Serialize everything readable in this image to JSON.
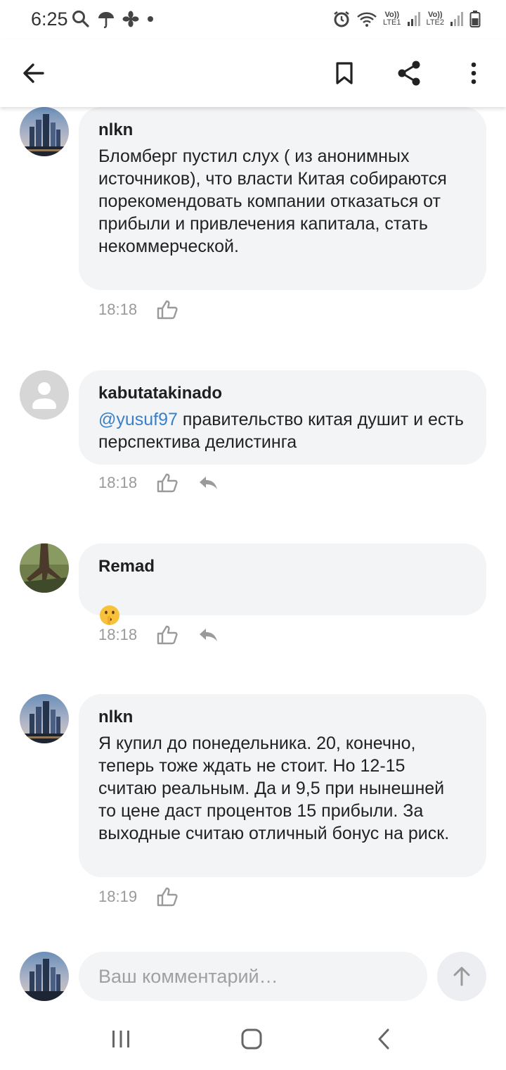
{
  "status_bar": {
    "time": "6:25",
    "sim1": "LTE1",
    "sim2": "LTE2",
    "volte": "Vo))"
  },
  "app_bar": {
    "icons": [
      "back-arrow-icon",
      "bookmark-icon",
      "share-icon",
      "more-vert-icon"
    ]
  },
  "comments": [
    {
      "author": "nlkn",
      "text": "Бломберг пустил слух ( из анонимных источников), что власти Китая собираются порекомендовать компании отказаться от прибыли и привлечения капитала, стать некоммерческой.",
      "time": "18:18",
      "avatar": "city-skyline"
    },
    {
      "author": "kabutatakinado",
      "mention": "@yusuf97",
      "text": " правительство китая душит и есть перспектива делистинга",
      "time": "18:18",
      "avatar": "default-user"
    },
    {
      "author": "Remad",
      "text": "🤫",
      "time": "18:18",
      "avatar": "tree-roots"
    },
    {
      "author": "nlkn",
      "text": "Я купил до понедельника. 20, конечно, теперь тоже ждать не стоит. Но 12-15 считаю реальным. Да и 9,5 при нынешней то цене даст процентов 15 прибыли. За выходные считаю отличный бонус на риск.",
      "time": "18:19",
      "avatar": "city-skyline"
    }
  ],
  "comment_input": {
    "placeholder": "Ваш комментарий…"
  },
  "colors": {
    "bubble": "#f3f4f6",
    "mention": "#3a7fc9",
    "meta": "#9a9a9a"
  }
}
